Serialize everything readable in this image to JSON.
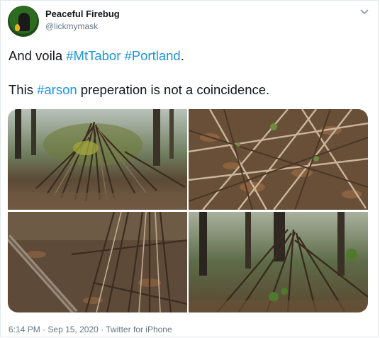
{
  "tweet": {
    "author": {
      "display_name": "Peaceful Firebug",
      "handle": "@lickmymask"
    },
    "text": {
      "line1_prefix": "And voila ",
      "hashtag1": "#MtTabor",
      "space": " ",
      "hashtag2": "#Portland",
      "line1_suffix": ".",
      "line2_prefix": "This ",
      "hashtag3": "#arson",
      "line2_suffix": " preperation is not a coincidence."
    },
    "time": "6:14 PM",
    "separator": "·",
    "date": "Sep 15, 2020",
    "source": "Twitter for iPhone"
  },
  "colors": {
    "link": "#1b95e0",
    "text": "#14171a",
    "muted": "#657786"
  },
  "icons": {
    "menu": "chevron-down-icon"
  }
}
